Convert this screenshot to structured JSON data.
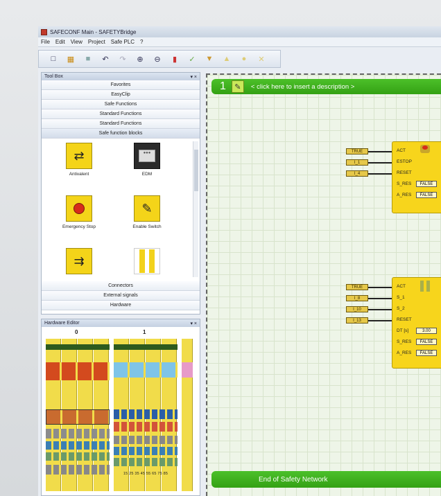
{
  "window": {
    "title": "SAFECONF Main - SAFETYBridge"
  },
  "menu": [
    "File",
    "Edit",
    "View",
    "Project",
    "Safe PLC",
    "?"
  ],
  "toolbox": {
    "title": "Tool Box",
    "pin_controls": "▾ ×",
    "categories_top": [
      "Favorites",
      "EasyClip",
      "Safe Functions",
      "Standard Functions",
      "Standard Functions",
      "Safe function blocks"
    ],
    "tools": [
      {
        "label": "Antivalent",
        "icon": "antivalent-switch-icon"
      },
      {
        "label": "EDM",
        "icon": "contactor-icon"
      },
      {
        "label": "Emergency Stop",
        "icon": "emergency-stop-icon"
      },
      {
        "label": "Enable Switch",
        "icon": "enable-switch-icon"
      },
      {
        "label": "",
        "icon": "two-hand-switch-icon"
      },
      {
        "label": "",
        "icon": "light-curtain-icon"
      }
    ],
    "categories_bottom": [
      "Connectors",
      "External signals",
      "Hardware"
    ]
  },
  "hardware_editor": {
    "title": "Hardware Editor",
    "pin_controls": "▾ ×",
    "columns": [
      "0",
      "1"
    ],
    "terminal_labels": "15 25 35 45 55 65 75 85"
  },
  "network": {
    "number": "1",
    "description": "< click here to insert a description >",
    "footer": "End of Safety Network",
    "block1": {
      "inputs": [
        {
          "const": "TRUE",
          "pin": "ACT"
        },
        {
          "const": "I_1",
          "pin": "ESTOP"
        },
        {
          "const": "I_4",
          "pin": "RESET"
        }
      ],
      "params": [
        {
          "pin": "S_RES",
          "value": "FALSE"
        },
        {
          "pin": "A_RES",
          "value": "FALSE"
        }
      ],
      "right_labels": [
        "S"
      ]
    },
    "block2": {
      "inputs": [
        {
          "const": "TRUE",
          "pin": "ACT"
        },
        {
          "const": "I_8",
          "pin": "S_1"
        },
        {
          "const": "I_10",
          "pin": "S_2"
        },
        {
          "const": "I_13",
          "pin": "RESET"
        }
      ],
      "params": [
        {
          "pin": "DT [s]",
          "value": "3.00"
        },
        {
          "pin": "S_RES",
          "value": "FALSE"
        },
        {
          "pin": "A_RES",
          "value": "FALSE"
        }
      ],
      "right_labels": [
        "S",
        "R"
      ]
    }
  }
}
